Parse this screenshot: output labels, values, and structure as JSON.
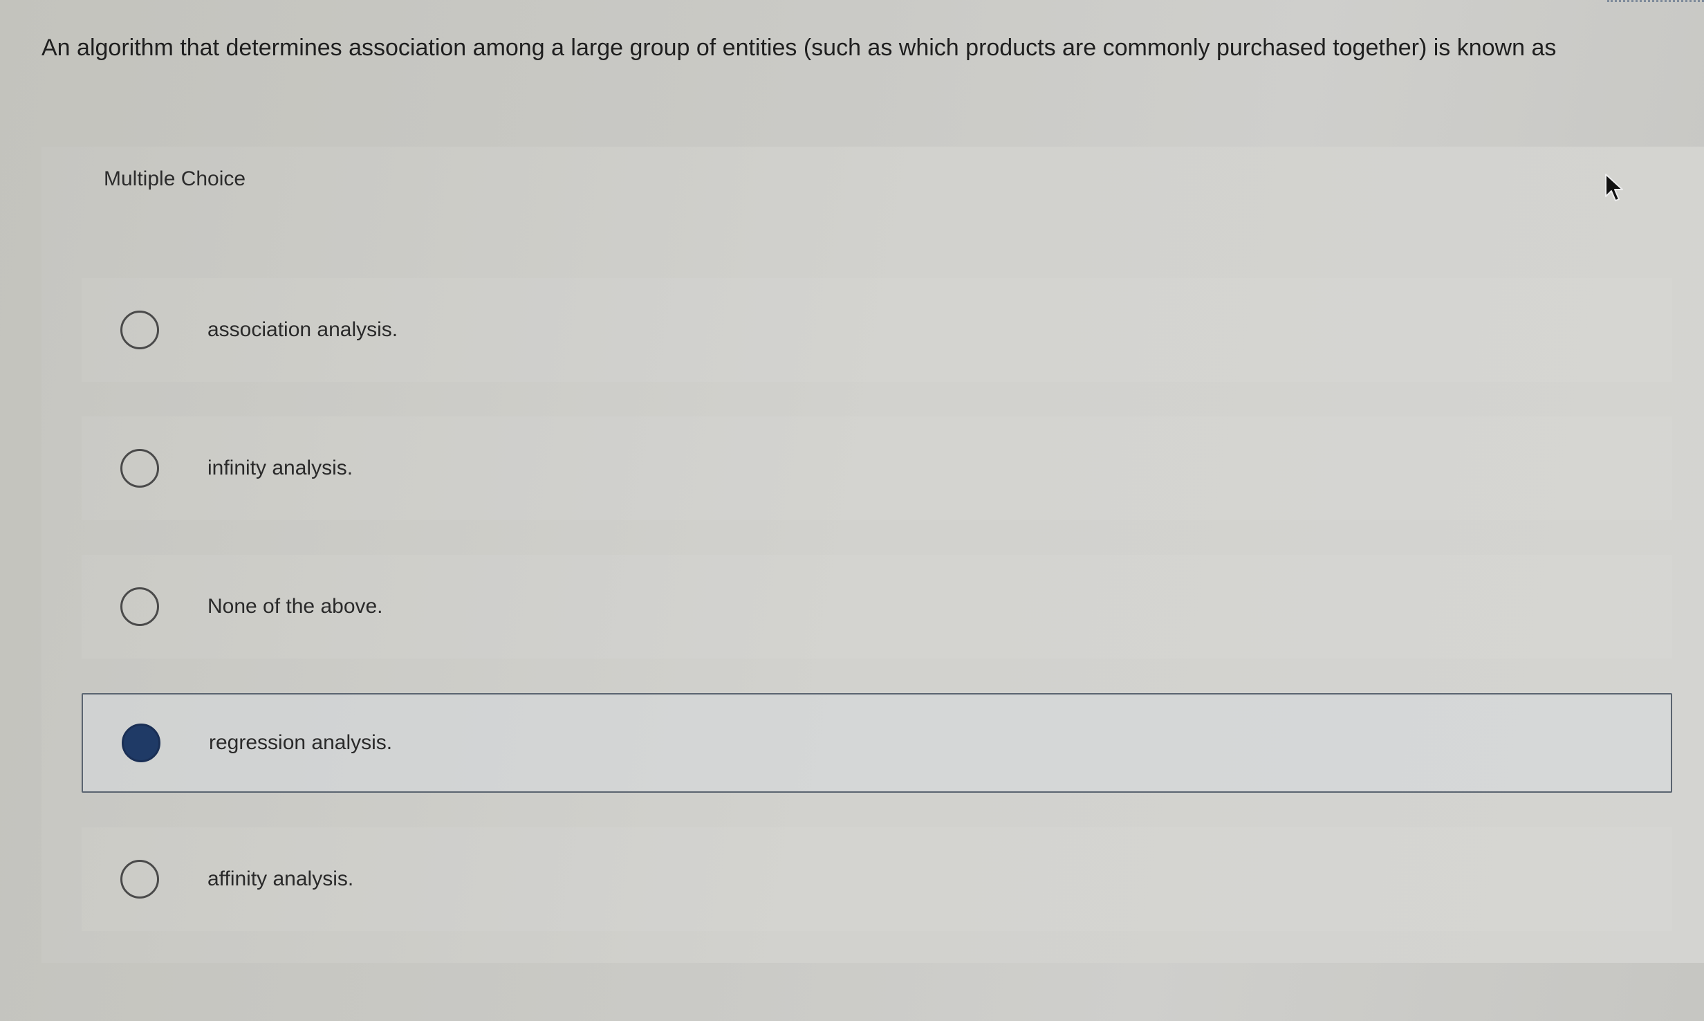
{
  "question": {
    "text": "An algorithm that determines association among a large group of entities (such as which products are commonly purchased together) is known as"
  },
  "card": {
    "header": "Multiple Choice"
  },
  "options": [
    {
      "label": "association analysis.",
      "selected": false
    },
    {
      "label": "infinity analysis.",
      "selected": false
    },
    {
      "label": "None of the above.",
      "selected": false
    },
    {
      "label": "regression analysis.",
      "selected": true
    },
    {
      "label": "affinity analysis.",
      "selected": false
    }
  ],
  "colors": {
    "selected_radio": "#1f3a66",
    "selected_border": "#5a6470"
  },
  "icons": {
    "cursor": "mouse-pointer-icon"
  }
}
